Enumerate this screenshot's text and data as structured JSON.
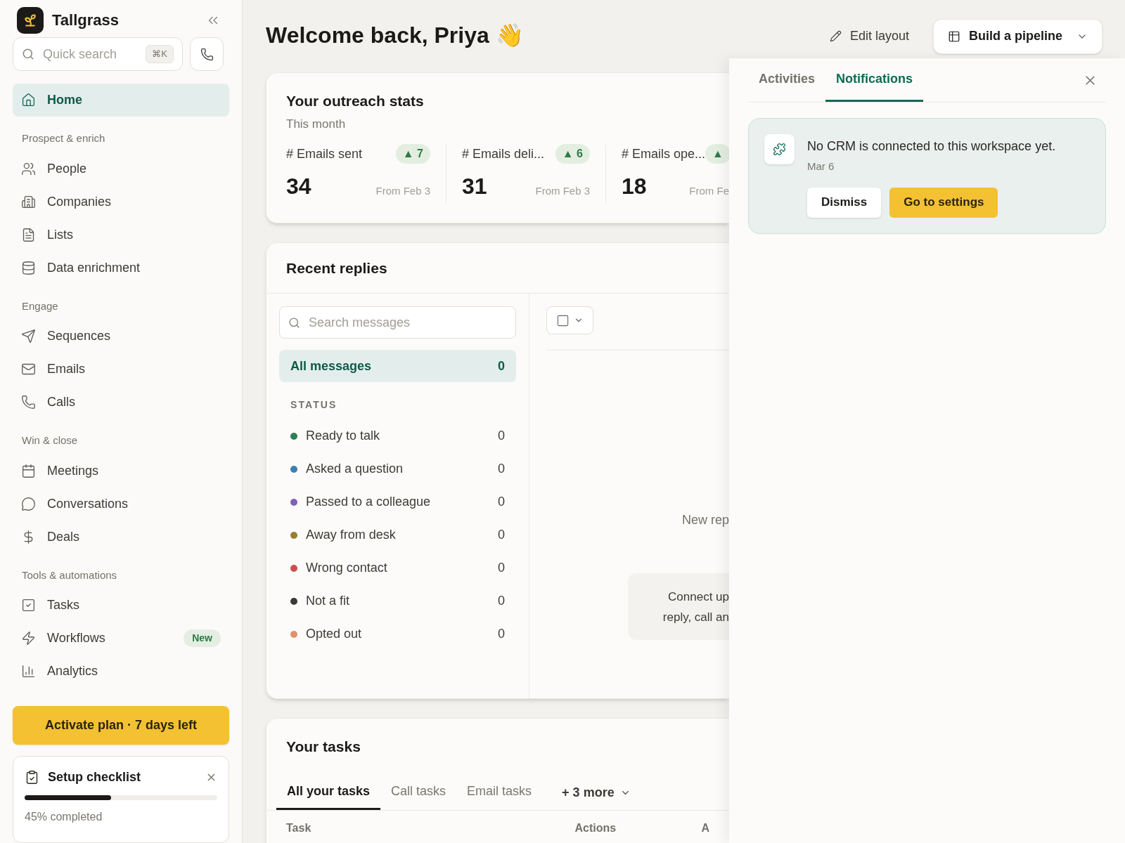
{
  "sidebar": {
    "brand": "Tallgrass",
    "search": {
      "placeholder": "Quick search",
      "shortcut": "⌘K"
    },
    "sections": [
      {
        "items": [
          {
            "label": "Home",
            "selected": true
          }
        ]
      },
      {
        "heading": "Prospect & enrich",
        "items": [
          {
            "label": "People",
            "selected": false
          },
          {
            "label": "Companies",
            "selected": false
          },
          {
            "label": "Lists",
            "selected": false
          },
          {
            "label": "Data enrichment",
            "selected": false
          }
        ]
      },
      {
        "heading": "Engage",
        "items": [
          {
            "label": "Sequences",
            "selected": false
          },
          {
            "label": "Emails",
            "selected": false
          },
          {
            "label": "Calls",
            "selected": false
          }
        ]
      },
      {
        "heading": "Win & close",
        "items": [
          {
            "label": "Meetings",
            "selected": false
          },
          {
            "label": "Conversations",
            "selected": false
          },
          {
            "label": "Deals",
            "selected": false
          }
        ]
      },
      {
        "heading": "Tools & automations",
        "items": [
          {
            "label": "Tasks",
            "selected": false
          },
          {
            "label": "Workflows",
            "selected": false,
            "badge": "New"
          },
          {
            "label": "Analytics",
            "selected": false
          }
        ]
      }
    ],
    "plan_button": "Activate plan · 7 days left",
    "checklist": {
      "title": "Setup checklist",
      "level": 0.45,
      "caption": "45% completed"
    }
  },
  "header": {
    "title": "Welcome back, Priya",
    "emoji": "👋",
    "edit_layout": "Edit layout",
    "pipeline_button": "Build a pipeline"
  },
  "stats": {
    "title": "Your outreach stats",
    "subtitle": "This month",
    "items": [
      {
        "label": "# Emails sent",
        "delta": "▲ 7",
        "value": "34",
        "since": "From Feb 3"
      },
      {
        "label": "# Emails deli...",
        "delta": "▲ 6",
        "value": "31",
        "since": "From Feb 3"
      },
      {
        "label": "# Emails ope...",
        "delta": "▲",
        "value": "18",
        "since": "From Fe"
      }
    ]
  },
  "replies": {
    "title": "Recent replies",
    "search_placeholder": "Search messages",
    "all": {
      "label": "All messages",
      "count": "0",
      "selected": true
    },
    "status_heading": "STATUS",
    "statuses": [
      {
        "label": "Ready to talk",
        "count": "0",
        "color": "#2e7d57"
      },
      {
        "label": "Asked a question",
        "count": "0",
        "color": "#3b7fb5"
      },
      {
        "label": "Passed to a colleague",
        "count": "0",
        "color": "#8160b8"
      },
      {
        "label": "Away from desk",
        "count": "0",
        "color": "#9a7d2e"
      },
      {
        "label": "Wrong contact",
        "count": "0",
        "color": "#c8514a"
      },
      {
        "label": "Not a fit",
        "count": "0",
        "color": "#3a3a3a"
      },
      {
        "label": "Opted out",
        "count": "0",
        "color": "#e0906a"
      }
    ],
    "empty_title": "New rep",
    "empty_hint": [
      "Connect up",
      "reply, call an"
    ]
  },
  "tasks": {
    "title": "Your tasks",
    "tabs": [
      {
        "label": "All your tasks",
        "selected": true
      },
      {
        "label": "Call tasks",
        "selected": false
      },
      {
        "label": "Email tasks",
        "selected": false
      }
    ],
    "more": "+ 3 more",
    "columns": [
      "Task",
      "Actions",
      "A"
    ]
  },
  "panel": {
    "tabs": [
      {
        "label": "Activities",
        "selected": false
      },
      {
        "label": "Notifications",
        "selected": true
      }
    ],
    "notification": {
      "message": "No CRM is connected to this workspace yet.",
      "date": "Mar 6",
      "dismiss": "Dismiss",
      "action": "Go to settings"
    }
  }
}
